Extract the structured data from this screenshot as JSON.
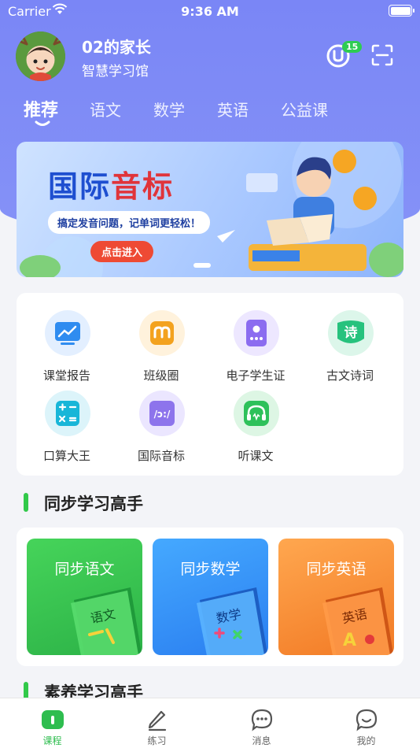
{
  "status_bar": {
    "carrier": "Carrier",
    "time": "9:36 AM"
  },
  "profile": {
    "name": "02的家长",
    "subtitle": "智慧学习馆",
    "coin_badge": "15"
  },
  "tabs": [
    {
      "label": "推荐",
      "active": true
    },
    {
      "label": "语文",
      "active": false
    },
    {
      "label": "数学",
      "active": false
    },
    {
      "label": "英语",
      "active": false
    },
    {
      "label": "公益课",
      "active": false
    }
  ],
  "banner": {
    "title_part1": "国际",
    "title_part2": "音标",
    "subtitle": "搞定发音问题，记单词更轻松！",
    "button": "点击进入"
  },
  "tools": [
    {
      "label": "课堂报告",
      "icon": "chart-report-icon",
      "color": "#2f8cf0",
      "bg": "#e3efff"
    },
    {
      "label": "班级圈",
      "icon": "class-circle-icon",
      "color": "#f3a21e",
      "bg": "#fff2dc"
    },
    {
      "label": "电子学生证",
      "icon": "student-card-icon",
      "color": "#8b6cf0",
      "bg": "#ede7ff"
    },
    {
      "label": "古文诗词",
      "icon": "poetry-icon",
      "color": "#26c27d",
      "bg": "#dcf6ea"
    },
    {
      "label": "口算大王",
      "icon": "calculator-icon",
      "color": "#18b6d8",
      "bg": "#dcf4fa"
    },
    {
      "label": "国际音标",
      "icon": "phonetic-icon",
      "color": "#8d74ec",
      "bg": "#ebe6ff"
    },
    {
      "label": "听课文",
      "icon": "headphones-icon",
      "color": "#2ec15a",
      "bg": "#ddf6e4"
    }
  ],
  "sections": {
    "sync": "同步学习高手",
    "quality": "素养学习高手"
  },
  "subjects": [
    {
      "label": "同步语文",
      "book_text": "语文",
      "from": "#3fcf55",
      "to": "#2cb247"
    },
    {
      "label": "同步数学",
      "book_text": "数学",
      "from": "#3aa0ff",
      "to": "#2a7ef0"
    },
    {
      "label": "同步英语",
      "book_text": "英语",
      "from": "#ffa04a",
      "to": "#f27a25"
    }
  ],
  "tabbar": [
    {
      "label": "课程",
      "icon": "course-icon",
      "active": true
    },
    {
      "label": "练习",
      "icon": "practice-pencil-icon",
      "active": false
    },
    {
      "label": "消息",
      "icon": "message-bubble-icon",
      "active": false
    },
    {
      "label": "我的",
      "icon": "profile-smile-icon",
      "active": false
    }
  ],
  "colors": {
    "header": "#7a86f6",
    "accent_green": "#2ebd4f",
    "banner_red": "#e0343a"
  }
}
